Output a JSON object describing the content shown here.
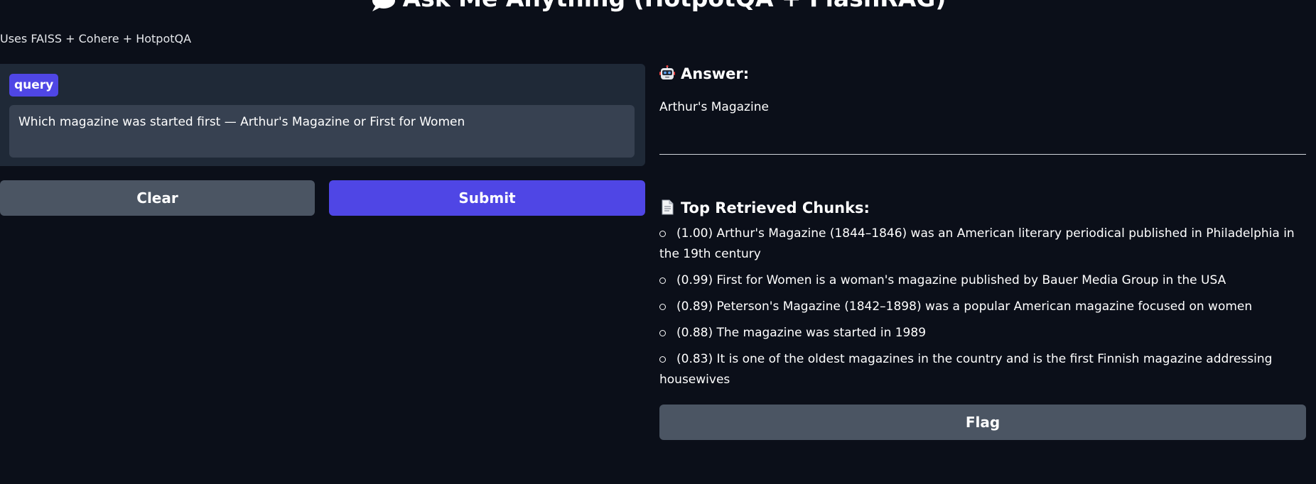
{
  "header": {
    "title": "Ask Me Anything (HotpotQA + FlashRAG)",
    "subtitle": "Uses FAISS + Cohere + HotpotQA"
  },
  "query": {
    "label": "query",
    "value": "Which magazine was started first — Arthur's Magazine or First for Women"
  },
  "buttons": {
    "clear": "Clear",
    "submit": "Submit",
    "flag": "Flag"
  },
  "answer": {
    "heading": "Answer:",
    "text": "Arthur's Magazine"
  },
  "chunks": {
    "heading": "Top Retrieved Chunks:",
    "items": [
      "(1.00) Arthur's Magazine (1844–1846) was an American literary periodical published in Philadelphia in the 19th century",
      "(0.99) First for Women is a woman's magazine published by Bauer Media Group in the USA",
      "(0.89) Peterson's Magazine (1842–1898) was a popular American magazine focused on women",
      "(0.88) The magazine was started in 1989",
      "(0.83) It is one of the oldest magazines in the country and is the first Finnish magazine addressing housewives"
    ]
  },
  "icons": {
    "title": "speech-bubble-icon",
    "answer": "robot-icon",
    "chunks": "document-icon"
  },
  "colors": {
    "background": "#0b0f19",
    "panel": "#1f2937",
    "input": "#374151",
    "accent": "#4f46e5",
    "secondary_button": "#4b5563"
  }
}
